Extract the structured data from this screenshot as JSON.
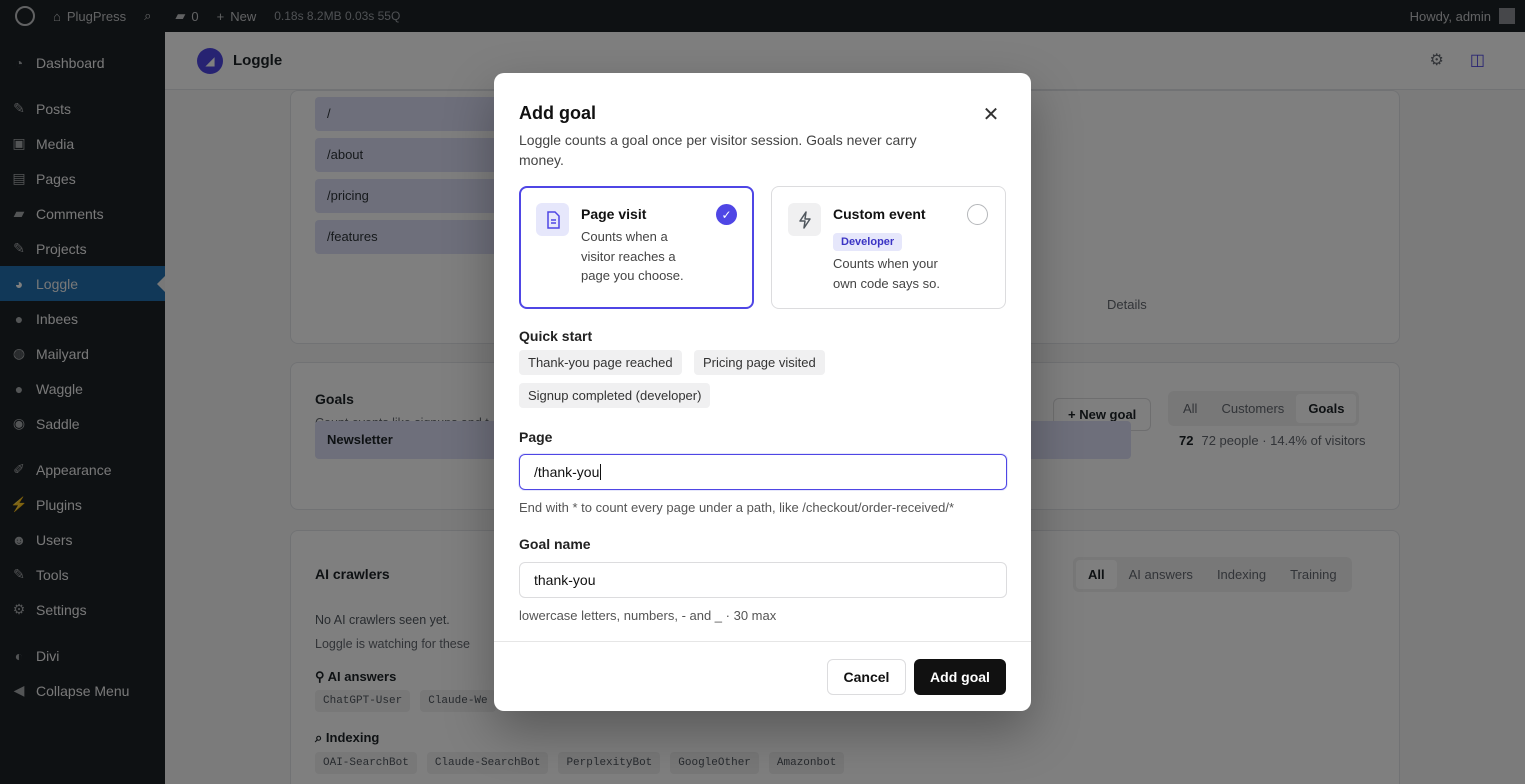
{
  "adminbar": {
    "site_name": "PlugPress",
    "search_count": "",
    "comments_count": "0",
    "new_label": "New",
    "perf": "0.18s  8.2MB  0.03s  55Q",
    "howdy": "Howdy, admin"
  },
  "sidebar": {
    "items": [
      {
        "label": "Dashboard",
        "icon": "dashboard-icon"
      },
      {
        "label": "Posts",
        "icon": "pin-icon"
      },
      {
        "label": "Media",
        "icon": "media-icon"
      },
      {
        "label": "Pages",
        "icon": "pages-icon"
      },
      {
        "label": "Comments",
        "icon": "comments-icon"
      },
      {
        "label": "Projects",
        "icon": "pin-icon"
      },
      {
        "label": "Loggle",
        "icon": "chart-icon"
      },
      {
        "label": "Inbees",
        "icon": "circle-icon"
      },
      {
        "label": "Mailyard",
        "icon": "globe-icon"
      },
      {
        "label": "Waggle",
        "icon": "circle-icon"
      },
      {
        "label": "Saddle",
        "icon": "circle-icon"
      },
      {
        "label": "Appearance",
        "icon": "brush-icon"
      },
      {
        "label": "Plugins",
        "icon": "plugin-icon"
      },
      {
        "label": "Users",
        "icon": "users-icon"
      },
      {
        "label": "Tools",
        "icon": "tools-icon"
      },
      {
        "label": "Settings",
        "icon": "settings-icon"
      },
      {
        "label": "Divi",
        "icon": "divi-icon"
      },
      {
        "label": "Collapse Menu",
        "icon": "collapse-icon"
      }
    ]
  },
  "plugin": {
    "name": "Loggle"
  },
  "background": {
    "pages": [
      "/",
      "/about",
      "/pricing",
      "/features"
    ],
    "details_label": "Details",
    "goals_title": "Goals",
    "goals_sub": "Count events like signups and t",
    "new_goal_label": "New goal",
    "goals_filters": [
      "All",
      "Customers",
      "Goals"
    ],
    "goal_row_name": "Newsletter",
    "goal_row_count": "72",
    "goal_row_meta": "72 people · 14.4% of visitors",
    "crawlers_title": "AI crawlers",
    "crawlers_filters": [
      "All",
      "AI answers",
      "Indexing",
      "Training"
    ],
    "crawlers_empty": "No AI crawlers seen yet.",
    "crawlers_watching": "Loggle is watching for these",
    "ai_answers_label": "AI answers",
    "ai_answers_chips": [
      "ChatGPT-User",
      "Claude-We"
    ],
    "indexing_label": "Indexing",
    "indexing_chips": [
      "OAI-SearchBot",
      "Claude-SearchBot",
      "PerplexityBot",
      "GoogleOther",
      "Amazonbot"
    ]
  },
  "modal": {
    "title": "Add goal",
    "description": "Loggle counts a goal once per visitor session. Goals never carry money.",
    "options": [
      {
        "title": "Page visit",
        "desc": "Counts when a visitor reaches a page you choose.",
        "selected": true
      },
      {
        "title": "Custom event",
        "badge": "Developer",
        "desc": "Counts when your own code says so.",
        "selected": false
      }
    ],
    "quick_start_label": "Quick start",
    "quick_start_chips": [
      "Thank-you page reached",
      "Pricing page visited",
      "Signup completed (developer)"
    ],
    "page_label": "Page",
    "page_value": "/thank-you",
    "page_help": "End with * to count every page under a path, like /checkout/order-received/*",
    "goal_name_label": "Goal name",
    "goal_name_value": "thank-you",
    "goal_name_help": "lowercase letters, numbers, - and _ · 30 max",
    "cancel_label": "Cancel",
    "submit_label": "Add goal"
  },
  "colors": {
    "accent": "#4f46e5",
    "accent_soft": "#e6e7fb",
    "admin_dark": "#1d2327",
    "primary_button": "#111111"
  }
}
